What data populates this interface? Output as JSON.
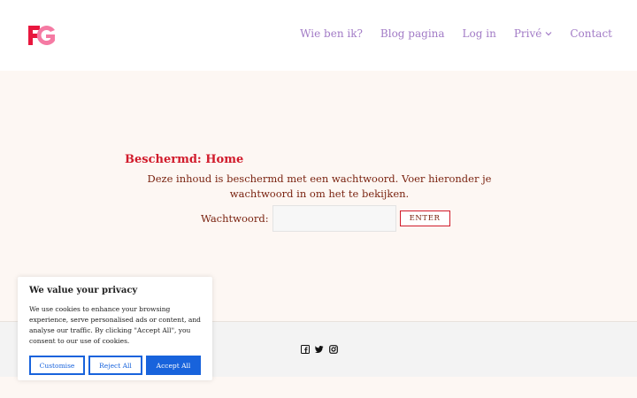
{
  "header": {
    "logo_text": "FG",
    "nav": [
      {
        "label": "Wie ben ik?"
      },
      {
        "label": "Blog pagina"
      },
      {
        "label": "Log in"
      },
      {
        "label": "Privé",
        "has_dropdown": true
      },
      {
        "label": "Contact"
      }
    ]
  },
  "content": {
    "title": "Beschermd: Home",
    "message": "Deze inhoud is beschermd met een wachtwoord. Voer hieronder je wachtwoord in om het te bekijken.",
    "password_label": "Wachtwoord:",
    "password_value": "",
    "submit_label": "ENTER"
  },
  "footer": {
    "social_icons": [
      "facebook-icon",
      "twitter-icon",
      "instagram-icon"
    ]
  },
  "cookie_banner": {
    "title": "We value your privacy",
    "text": "We use cookies to enhance your browsing experience, serve personalised ads or content, and analyse our traffic. By clicking \"Accept All\", you consent to our use of cookies.",
    "customise_label": "Customise",
    "reject_label": "Reject All",
    "accept_label": "Accept All"
  },
  "colors": {
    "nav": "#a27bc6",
    "title": "#d11b2b",
    "text": "#7a2310",
    "button_primary": "#1863dc",
    "background": "#fdf7f3"
  }
}
